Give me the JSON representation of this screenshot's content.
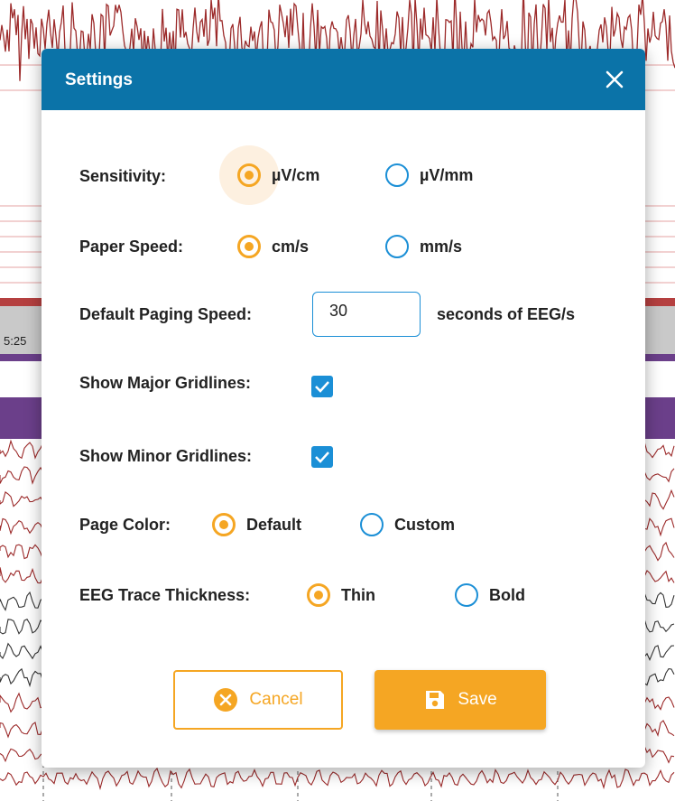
{
  "background": {
    "time_label": "5:25"
  },
  "dialog": {
    "title": "Settings",
    "close_icon": "close-icon",
    "sensitivity": {
      "label": "Sensitivity:",
      "options": [
        "µV/cm",
        "µV/mm"
      ],
      "selected": "µV/cm"
    },
    "paper_speed": {
      "label": "Paper Speed:",
      "options": [
        "cm/s",
        "mm/s"
      ],
      "selected": "cm/s"
    },
    "paging_speed": {
      "label": "Default Paging Speed:",
      "value": "30",
      "unit": "seconds of EEG/s"
    },
    "major_gridlines": {
      "label": "Show Major Gridlines:",
      "checked": true
    },
    "minor_gridlines": {
      "label": "Show Minor Gridlines:",
      "checked": true
    },
    "page_color": {
      "label": "Page Color:",
      "options": [
        "Default",
        "Custom"
      ],
      "selected": "Default"
    },
    "trace_thickness": {
      "label": "EEG Trace Thickness:",
      "options": [
        "Thin",
        "Bold"
      ],
      "selected": "Thin"
    },
    "buttons": {
      "cancel": "Cancel",
      "save": "Save"
    }
  },
  "colors": {
    "header": "#0b73a8",
    "accent": "#f5a623",
    "radio_unselected": "#1b8fd6",
    "trace_red": "#9c2a2a",
    "band_purple": "#6b3f8a"
  }
}
